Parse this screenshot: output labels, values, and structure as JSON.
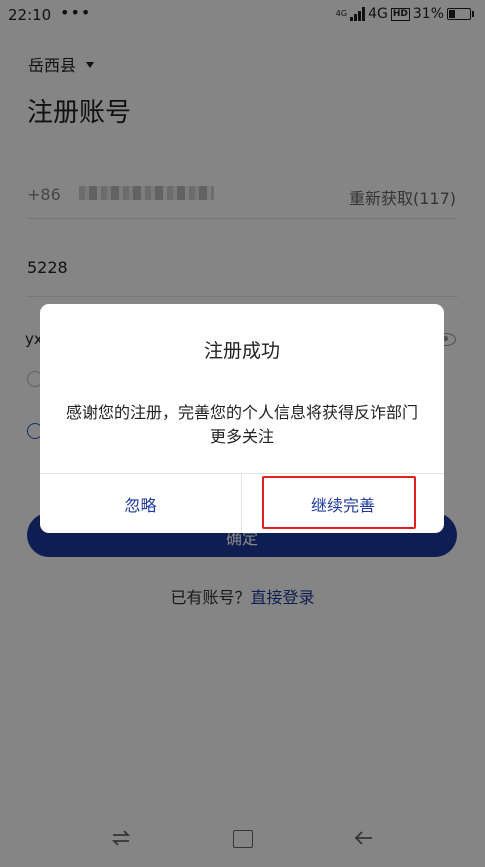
{
  "status_bar": {
    "time": "22:10",
    "dots": "•••",
    "network_small": "4G",
    "network": "4G",
    "hd": "HD",
    "battery": "31%"
  },
  "page": {
    "county": "岳西县",
    "title": "注册账号",
    "phone_prefix": "+86",
    "resend_label": "重新获取(117)",
    "code_value": "5228",
    "password_value": "yx",
    "confirm_label": "确定",
    "login_prompt": "已有账号？",
    "login_link": "直接登录"
  },
  "dialog": {
    "title": "注册成功",
    "message": "感谢您的注册，完善您的个人信息将获得反诈部门更多关注",
    "ignore_label": "忽略",
    "continue_label": "继续完善"
  },
  "colors": {
    "accent": "#1e3a9e",
    "highlight": "#e02020"
  }
}
